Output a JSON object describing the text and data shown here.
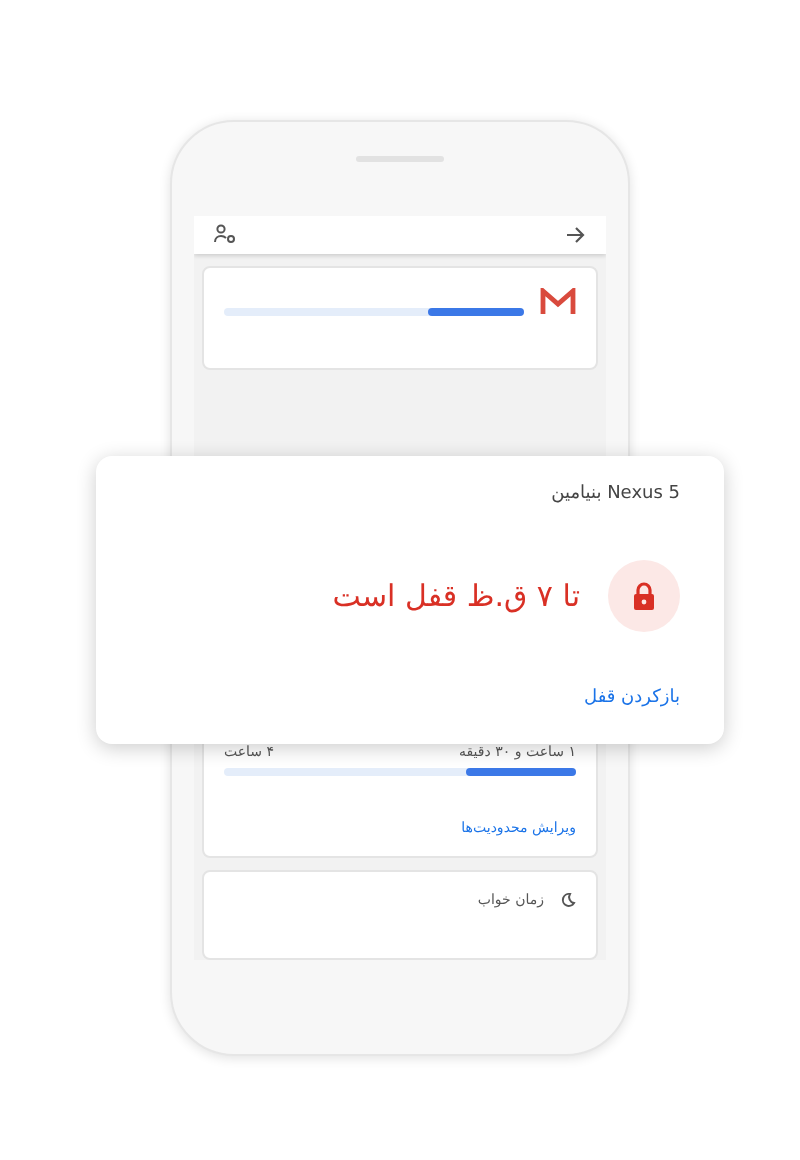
{
  "phone": {
    "gmail_usage": {
      "level": 0.32
    },
    "daily_limit": {
      "used": "۱ ساعت و ۳۰ دقیقه",
      "limit": "۴ ساعت",
      "level": 0.31,
      "link": "ویرایش محدودیت‌ها"
    },
    "bedtime": {
      "label": "زمان خواب"
    }
  },
  "lock_card": {
    "device": "Nexus 5 بنیامین",
    "status": "تا ۷ ق.ظ قفل است",
    "action": "بازکردن قفل"
  }
}
